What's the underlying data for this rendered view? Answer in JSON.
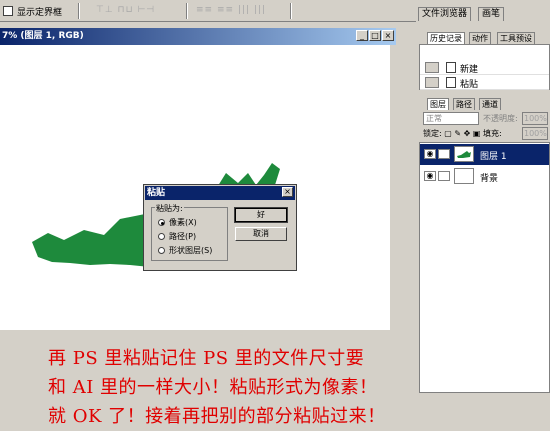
{
  "options_bar": {
    "show_bounds_label": "显示定界框",
    "dim_tools_a": "⊤⊥ ⊓⊔ ⊢⊣",
    "dim_tools_b": "≡≡ ≡≡ ||| |||"
  },
  "palette_well": {
    "tabs": [
      "文件浏览器",
      "画笔"
    ]
  },
  "document": {
    "title": "7% (图层 1, RGB)",
    "shape_color": "#1e8a3c"
  },
  "history_panel": {
    "tabs": [
      "历史记录",
      "动作",
      "工具预设"
    ],
    "items": [
      "新建",
      "粘贴"
    ]
  },
  "layers_panel": {
    "tabs": [
      "图层",
      "路径",
      "通道"
    ],
    "blend_mode": "正常",
    "opacity_label": "不透明度:",
    "opacity_value": "100%",
    "lock_label": "锁定:",
    "fill_label": "填充:",
    "fill_value": "100%",
    "layers": [
      {
        "name": "图层 1",
        "selected": true
      },
      {
        "name": "背景",
        "selected": false
      }
    ],
    "selected_color": "#0a246a"
  },
  "dialog": {
    "title": "粘贴",
    "group_label": "粘贴为:",
    "options": [
      "像素(X)",
      "路径(P)",
      "形状图层(S)"
    ],
    "selected_option": 0,
    "ok_label": "好",
    "cancel_label": "取消",
    "close_label": "×"
  },
  "annotation": {
    "lines": [
      "再 PS 里粘贴记住 PS 里的文件尺寸要",
      "和 AI 里的一样大小！粘贴形式为像素！",
      "就 OK 了！接着再把别的部分粘贴过来！"
    ],
    "color": "#e00000"
  }
}
